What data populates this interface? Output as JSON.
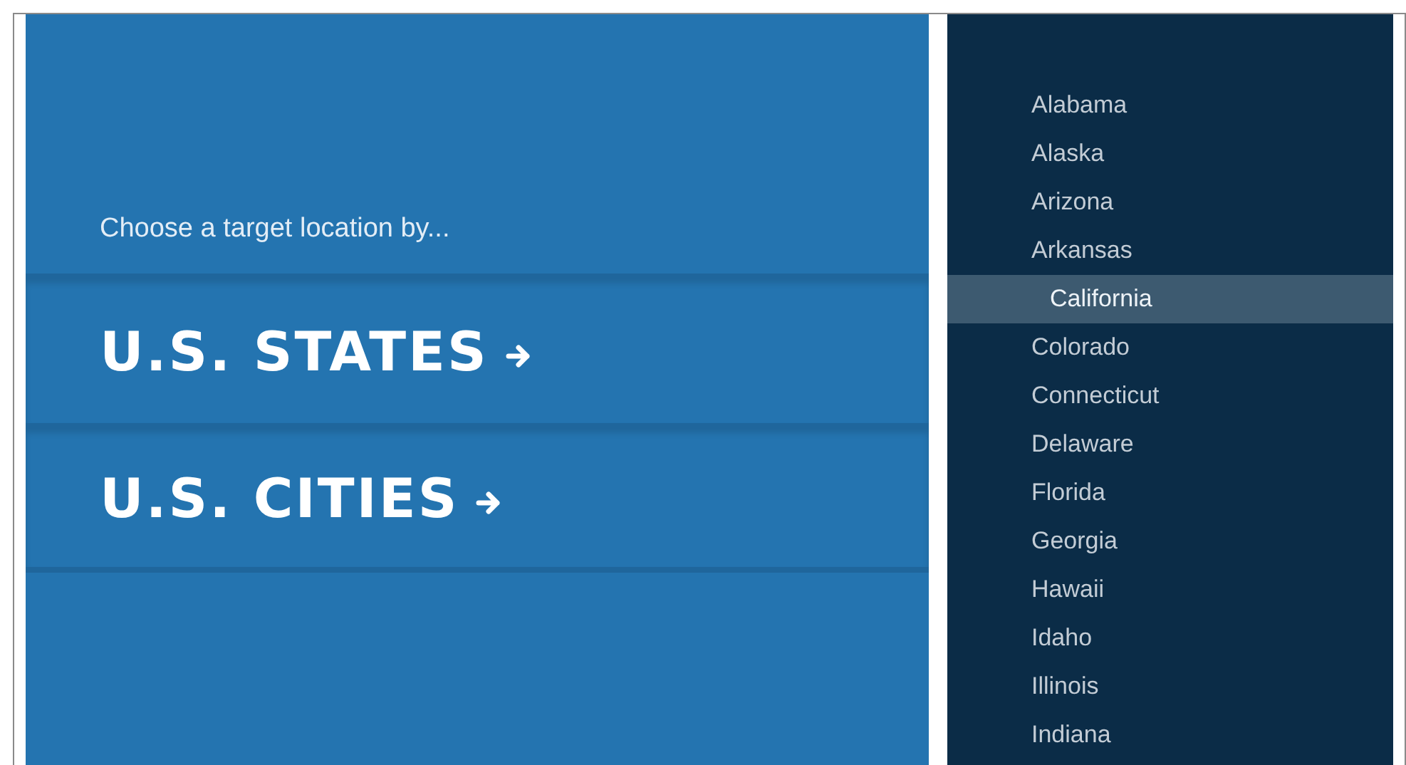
{
  "prompt": "Choose a target location by...",
  "options": [
    {
      "label": "U.S. STATES"
    },
    {
      "label": "U.S. CITIES"
    }
  ],
  "states": [
    {
      "name": "Alabama",
      "selected": false
    },
    {
      "name": "Alaska",
      "selected": false
    },
    {
      "name": "Arizona",
      "selected": false
    },
    {
      "name": "Arkansas",
      "selected": false
    },
    {
      "name": "California",
      "selected": true
    },
    {
      "name": "Colorado",
      "selected": false
    },
    {
      "name": "Connecticut",
      "selected": false
    },
    {
      "name": "Delaware",
      "selected": false
    },
    {
      "name": "Florida",
      "selected": false
    },
    {
      "name": "Georgia",
      "selected": false
    },
    {
      "name": "Hawaii",
      "selected": false
    },
    {
      "name": "Idaho",
      "selected": false
    },
    {
      "name": "Illinois",
      "selected": false
    },
    {
      "name": "Indiana",
      "selected": false
    }
  ]
}
